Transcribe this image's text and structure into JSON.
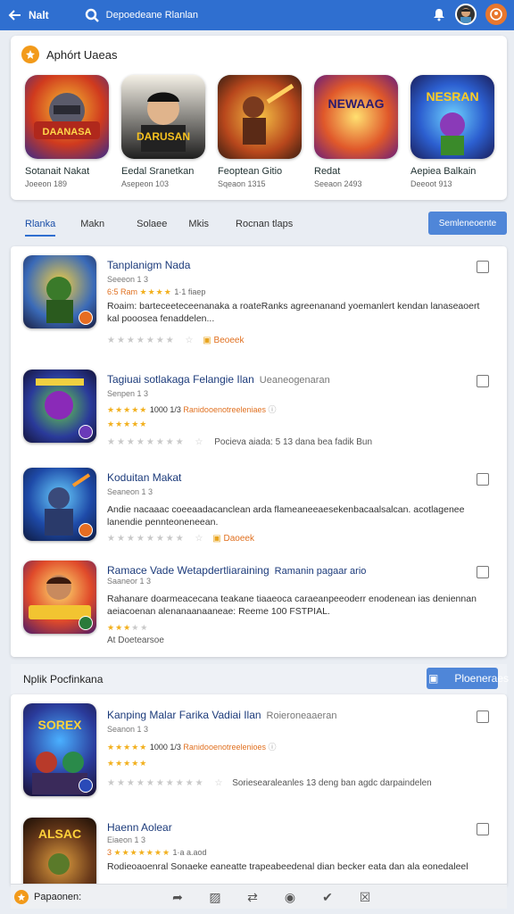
{
  "topbar": {
    "back_label": "Nalt",
    "search_text": "Depoedeane Rlanlan"
  },
  "featured": {
    "title": "Aphórt Uaeas",
    "items": [
      {
        "name": "Sotanait Nakat",
        "sub": "Joeeon 189",
        "art": "DAANASA"
      },
      {
        "name": "Eedal Sranetkan",
        "sub": "Asepeon 103",
        "art": "DARUSAN"
      },
      {
        "name": "Feoptean Gitio",
        "sub": "Sqeaon 1315",
        "art": ""
      },
      {
        "name": "Redat",
        "sub": "Seeaon 2493",
        "art": "NEWAAG"
      },
      {
        "name": "Aepiea Balkain",
        "sub": "Deeoot 913",
        "art": "NESRAN"
      }
    ]
  },
  "tabs": {
    "items": [
      "Rlanka",
      "Makn",
      "Solaee",
      "Mkis",
      "Rocnan tlaps"
    ],
    "button": "Semleneoente"
  },
  "list": [
    {
      "title": "Tanplanigm Nada",
      "extra": "",
      "sub": "Seeeon 1 3",
      "rating_text": "6:5 Ram",
      "rating_tail": "1·1 fiaep",
      "desc": "Roaim: barteceeteceenanaka a roateRanks agreenanand yoemanlert kendan lanaseaoert kal pooosea fenaddelen...",
      "footer_text": "",
      "footer_tag": "Beoeek"
    },
    {
      "title": "Tagiuai sotlakaga Felangie Ilan",
      "extra": "Ueaneogenaran",
      "sub": "Senpen 1 3",
      "rating_text": "1000 1/3",
      "rating_tail": "Ranidooenotreeleniaes",
      "desc": "",
      "footer_text": "Pocieva aiada: 5 13 dana bea fadik Bun",
      "footer_tag": ""
    },
    {
      "title": "Koduitan Makat",
      "extra": "",
      "sub": "Seaneon 1 3",
      "rating_text": "",
      "rating_tail": "",
      "desc": "Andie nacaaac coeeaadacanclean arda flameaneeaesekenbacaalsalcan. acotlagenee lanendie pennteoneneean.",
      "footer_text": "",
      "footer_tag": "Daoeek"
    },
    {
      "title": "Ramace Vade Wetapdertliaraining",
      "extra": "Ramanin pagaar ario",
      "sub": "Saaneor 1 3",
      "rating_text": "",
      "rating_tail": "",
      "desc": "Rahanare doarmeacecana teakane tiaaeoca caraeanpeeoderr enodenean ias deniennan aeiacoenan alenanaanaaneae: Reeme 100 FSTPIAL.",
      "footer_text": "At Doetearsoe",
      "footer_tag": ""
    }
  ],
  "section2": {
    "title": "Nplik Pocfinkana",
    "button": "Ploeneraes"
  },
  "list2": [
    {
      "title": "Kanping Malar Farika Vadiai Ilan",
      "extra": "Roieroneaaeran",
      "sub": "Seanon 1 3",
      "rating_text": "1000 1/3",
      "rating_tail": "Ranidooenotreelenioes",
      "footer_text": "Soriesearaleanles 13 deng ban agdc darpaindelen",
      "thumb": "SOREX"
    },
    {
      "title": "Haenn Aolear",
      "extra": "",
      "sub": "Eiaeon 1 3",
      "rating_text": "3",
      "rating_tail": "1·a a.aod",
      "desc": "Rodieoaoenral Sonaeke eaneatte trapeabeedenal dian becker eata dan ala eonedaleel",
      "thumb": "ALSAC"
    }
  ],
  "bottombar": {
    "label": "Papaonen:"
  }
}
